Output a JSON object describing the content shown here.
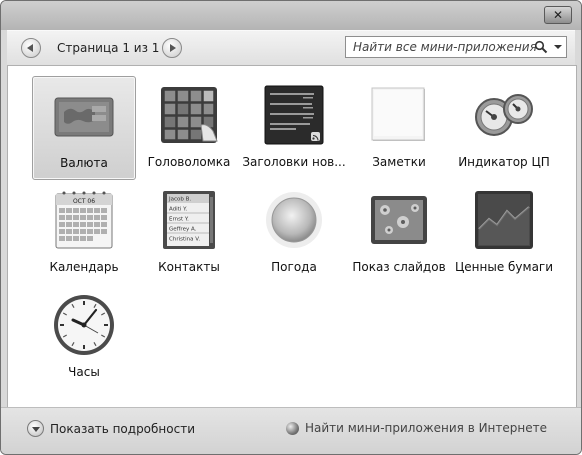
{
  "window": {
    "close_label": "✕"
  },
  "toolbar": {
    "page_label": "Страница 1 из 1",
    "search_placeholder": "Найти все мини-приложения"
  },
  "gadgets": [
    {
      "label": "Валюта",
      "icon": "currency-icon",
      "selected": true
    },
    {
      "label": "Головоломка",
      "icon": "puzzle-icon"
    },
    {
      "label": "Заголовки нов...",
      "icon": "feed-headlines-icon"
    },
    {
      "label": "Заметки",
      "icon": "notes-icon"
    },
    {
      "label": "Индикатор ЦП",
      "icon": "cpu-meter-icon"
    },
    {
      "label": "Календарь",
      "icon": "calendar-icon"
    },
    {
      "label": "Контакты",
      "icon": "contacts-icon"
    },
    {
      "label": "Погода",
      "icon": "weather-icon"
    },
    {
      "label": "Показ слайдов",
      "icon": "slideshow-icon"
    },
    {
      "label": "Ценные бумаги",
      "icon": "stocks-icon"
    },
    {
      "label": "Часы",
      "icon": "clock-icon"
    }
  ],
  "calendar_icon": {
    "month": "OCT 06"
  },
  "contacts_icon": {
    "names": [
      "Jacob B.",
      "Aditi Y.",
      "Ernst Y.",
      "Geffrey A.",
      "Christina V."
    ]
  },
  "footer": {
    "details_label": "Показать подробности",
    "online_link": "Найти мини-приложения в Интернете"
  }
}
